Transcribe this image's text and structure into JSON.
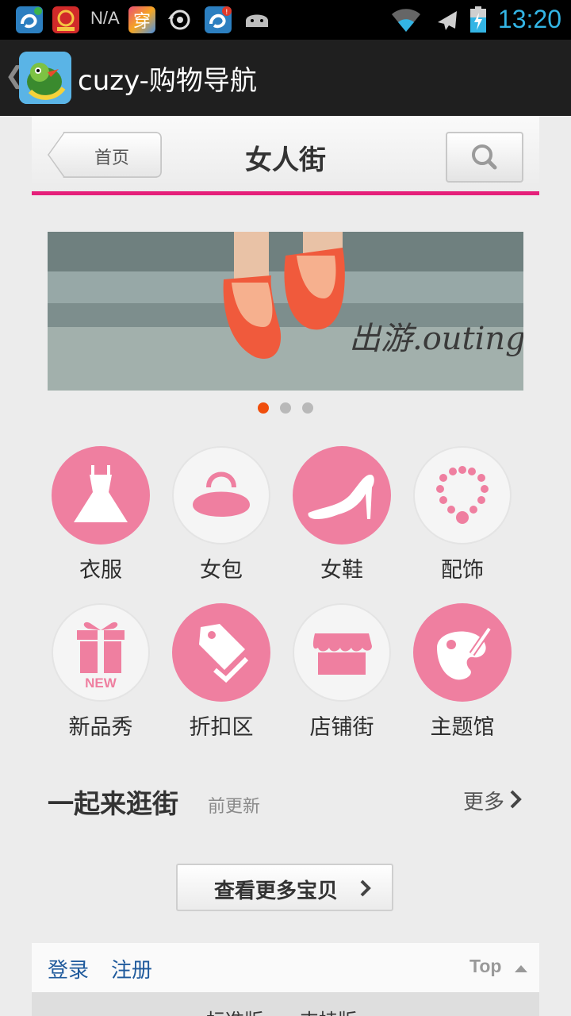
{
  "status_bar": {
    "network_text": "N/A",
    "time": "13:20",
    "notification_icons": [
      "weibo-icon",
      "phoenix-news-icon",
      "chuan-app-icon",
      "sync-icon",
      "weibo-alert-icon",
      "android-icon"
    ],
    "system_icons": [
      "wifi-icon",
      "airplane-icon",
      "battery-charging-icon"
    ]
  },
  "action_bar": {
    "title": "cuzy-购物导航",
    "back_icon": "chevron-left-icon",
    "app_icon": "bird-logo-icon"
  },
  "header": {
    "home_label": "首页",
    "title": "女人街",
    "search_icon": "search-icon",
    "accent_color": "#e5207a"
  },
  "banner": {
    "caption": "出游.outing",
    "page_count": 3,
    "active_page": 1,
    "active_dot_color": "#f04e0c"
  },
  "categories": [
    {
      "label": "衣服",
      "icon": "dress-icon"
    },
    {
      "label": "女包",
      "icon": "handbag-icon"
    },
    {
      "label": "女鞋",
      "icon": "high-heel-icon"
    },
    {
      "label": "配饰",
      "icon": "necklace-icon"
    },
    {
      "label": "新品秀",
      "icon": "gift-new-icon",
      "badge": "NEW"
    },
    {
      "label": "折扣区",
      "icon": "price-tag-icon"
    },
    {
      "label": "店铺街",
      "icon": "storefront-icon"
    },
    {
      "label": "主题馆",
      "icon": "palette-icon"
    }
  ],
  "section": {
    "title": "一起来逛街",
    "subtitle": "前更新",
    "more_label": "更多"
  },
  "more_button": {
    "label": "查看更多宝贝"
  },
  "footer": {
    "login": "登录",
    "register": "注册",
    "top": "Top",
    "bottom_links": [
      "标准版",
      "支持版"
    ]
  },
  "colors": {
    "pink": "#ef7fa0",
    "link_blue": "#1f5a9c",
    "status_time": "#33b5e5"
  }
}
